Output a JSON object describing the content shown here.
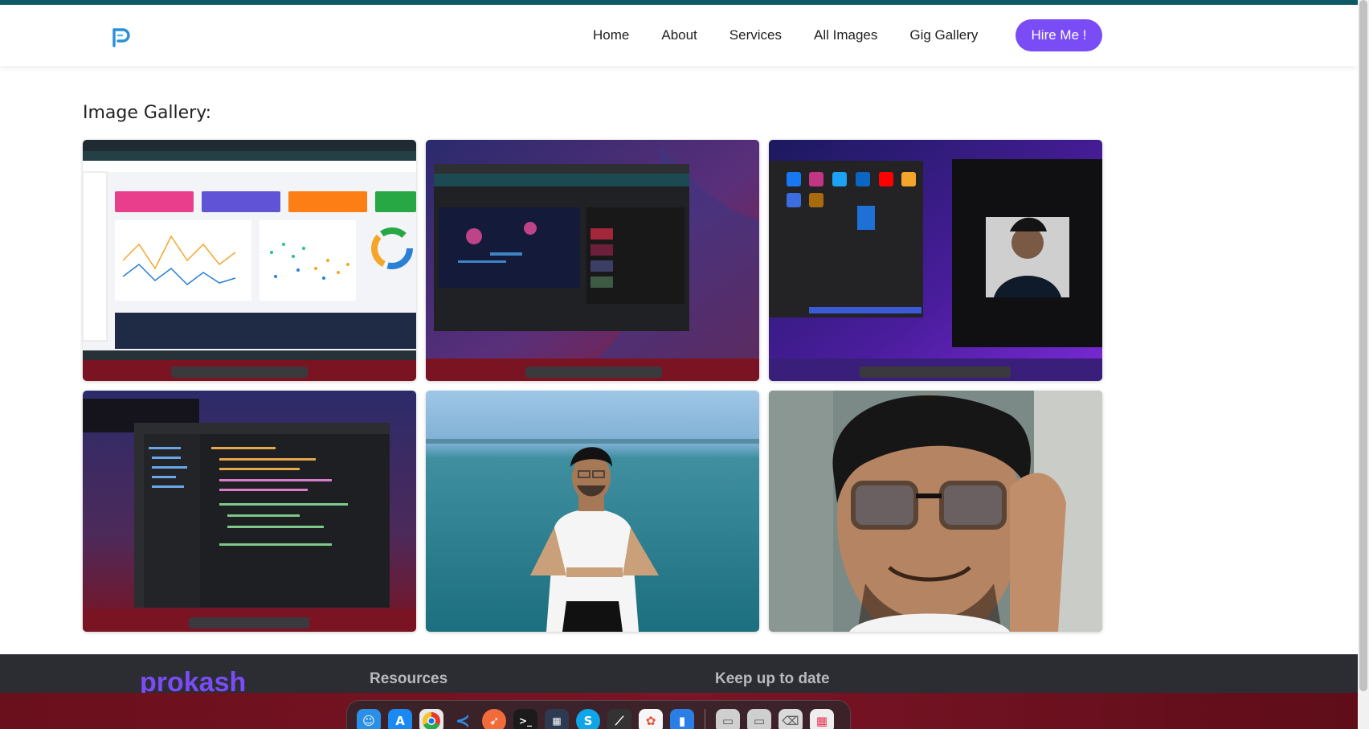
{
  "nav": {
    "logo": "P",
    "links": [
      "Home",
      "About",
      "Services",
      "All Images",
      "Gig Gallery"
    ],
    "hire_label": "Hire Me !"
  },
  "gallery": {
    "title": "Image Gallery:",
    "images": [
      {
        "name": "dashboard-screenshot"
      },
      {
        "name": "youtube-screenshot"
      },
      {
        "name": "social-icons-screenshot"
      },
      {
        "name": "code-editor-screenshot"
      },
      {
        "name": "portrait-sea"
      },
      {
        "name": "portrait-glasses"
      }
    ]
  },
  "footer": {
    "brand": "prokash",
    "resources_heading": "Resources",
    "newsletter_heading": "Keep up to date"
  },
  "dock": {
    "apps": [
      "finder-icon",
      "app-store-icon",
      "chrome-icon",
      "vscode-icon",
      "postman-icon",
      "terminal-icon",
      "calculator-icon",
      "skype-icon",
      "activity-icon",
      "photos-icon",
      "bookmarks-icon",
      "disk-icon",
      "disk-icon",
      "trash-icon",
      "apps-grid-icon"
    ]
  },
  "colors": {
    "accent": "#7a4cf5",
    "top_strip": "#0f5a66",
    "footer_bg": "#2b2d33"
  }
}
